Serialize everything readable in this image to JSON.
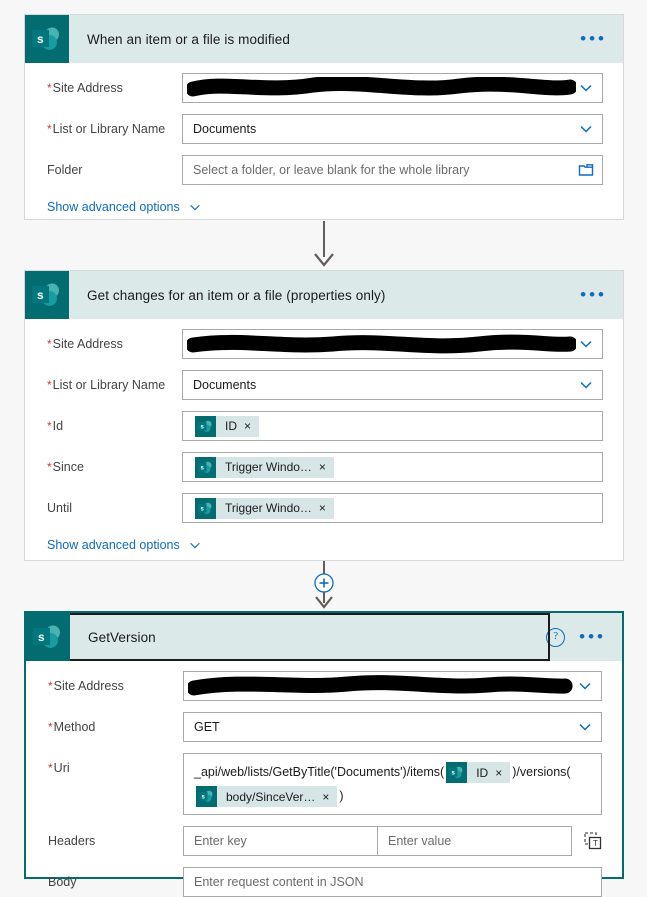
{
  "colors": {
    "sharepoint_teal": "#036c70",
    "header_bg": "#dbe9e9",
    "token_bg": "#d6e5e5",
    "link_blue": "#0f6cbd",
    "required_red": "#d13438",
    "page_bg": "#f7f7f7",
    "selected_border": "#036c70"
  },
  "cards": [
    {
      "id": "trigger-when-item-modified",
      "icon": "sharepoint-icon",
      "title": "When an item or a file is modified",
      "selected": false,
      "has_help": false,
      "menu": "•••",
      "rows": [
        {
          "label": "Site Address",
          "required": true,
          "type": "dropdown-redacted",
          "value": "",
          "redacted": true
        },
        {
          "label": "List or Library Name",
          "required": true,
          "type": "dropdown",
          "value": "Documents"
        },
        {
          "label": "Folder",
          "required": false,
          "type": "folder-picker",
          "placeholder": "Select a folder, or leave blank for the whole library"
        }
      ],
      "advanced_label": "Show advanced options"
    },
    {
      "id": "get-changes-for-item",
      "icon": "sharepoint-icon",
      "title": "Get changes for an item or a file (properties only)",
      "selected": false,
      "has_help": false,
      "menu": "•••",
      "rows": [
        {
          "label": "Site Address",
          "required": true,
          "type": "dropdown-redacted",
          "value": "",
          "redacted": true
        },
        {
          "label": "List or Library Name",
          "required": true,
          "type": "dropdown",
          "value": "Documents"
        },
        {
          "label": "Id",
          "required": true,
          "type": "token",
          "token": {
            "label": "ID",
            "close": "×",
            "icon": "sharepoint-icon"
          }
        },
        {
          "label": "Since",
          "required": true,
          "type": "token",
          "token": {
            "label": "Trigger Windo…",
            "close": "×",
            "icon": "sharepoint-icon"
          }
        },
        {
          "label": "Until",
          "required": false,
          "type": "token",
          "token": {
            "label": "Trigger Windo…",
            "close": "×",
            "icon": "sharepoint-icon"
          }
        }
      ],
      "advanced_label": "Show advanced options"
    },
    {
      "id": "get-version-http-request",
      "icon": "sharepoint-icon",
      "title": "GetVersion",
      "selected": true,
      "has_help": true,
      "help": "?",
      "menu": "•••",
      "rows": [
        {
          "label": "Site Address",
          "required": true,
          "type": "dropdown-redacted",
          "value": "",
          "redacted": true
        },
        {
          "label": "Method",
          "required": true,
          "type": "dropdown",
          "value": "GET"
        },
        {
          "label": "Uri",
          "required": true,
          "type": "uri",
          "uri_parts": [
            {
              "kind": "text",
              "value": "_api/web/lists/GetByTitle('Documents')/items("
            },
            {
              "kind": "token",
              "value": "ID",
              "close": "×"
            },
            {
              "kind": "text",
              "value": ")/versions("
            },
            {
              "kind": "token",
              "value": "body/SinceVer…",
              "close": "×"
            },
            {
              "kind": "text",
              "value": ")"
            }
          ]
        },
        {
          "label": "Headers",
          "required": false,
          "type": "key-value",
          "key_placeholder": "Enter key",
          "value_placeholder": "Enter value",
          "text_mode_icon": "text-mode-icon"
        },
        {
          "label": "Body",
          "required": false,
          "type": "textarea",
          "placeholder": "Enter request content in JSON"
        }
      ]
    }
  ],
  "connectors": [
    {
      "id": "connector-1",
      "has_add_button": false
    },
    {
      "id": "connector-2",
      "has_add_button": true,
      "add_label": "+"
    }
  ]
}
